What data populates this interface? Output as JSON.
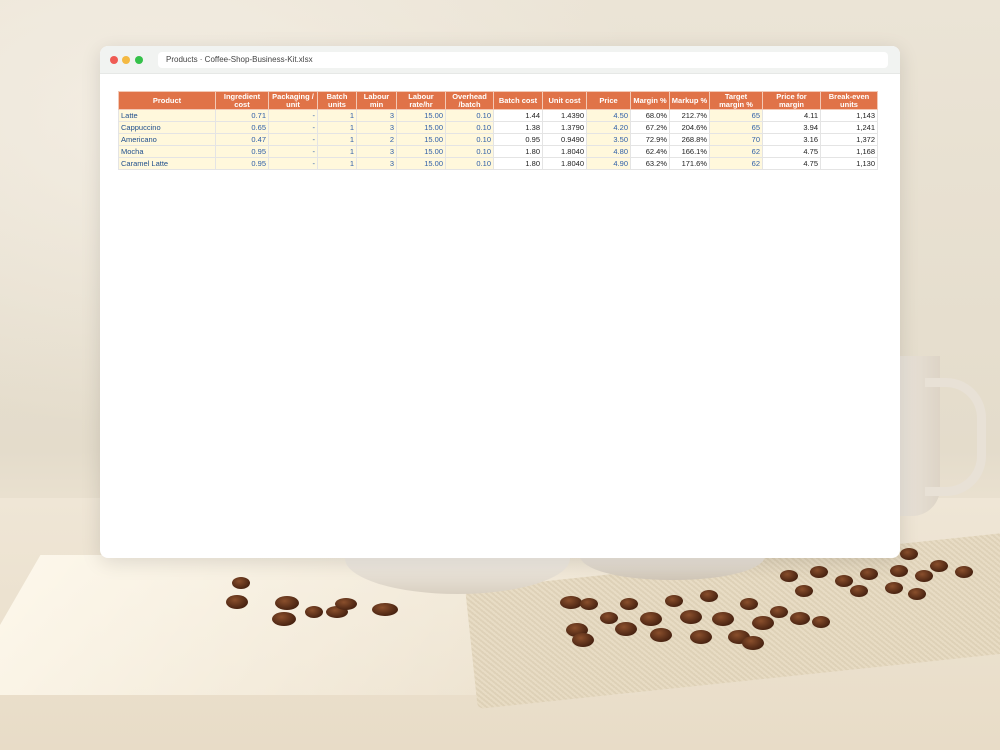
{
  "window": {
    "address": "Products · Coffee-Shop-Business-Kit.xlsx"
  },
  "table": {
    "headers": [
      [
        "Product"
      ],
      [
        "Ingredient",
        "cost"
      ],
      [
        "Packaging /",
        "unit"
      ],
      [
        "Batch",
        "units"
      ],
      [
        "Labour",
        "min"
      ],
      [
        "Labour",
        "rate/hr"
      ],
      [
        "Overhead",
        "/batch"
      ],
      [
        "Batch cost"
      ],
      [
        "Unit cost"
      ],
      [
        "Price"
      ],
      [
        "Margin %"
      ],
      [
        "Markup %"
      ],
      [
        "Target",
        "margin %"
      ],
      [
        "Price for",
        "margin"
      ],
      [
        "Break-even",
        "units"
      ]
    ],
    "rows": [
      [
        "Latte",
        "0.71",
        "-",
        "1",
        "3",
        "15.00",
        "0.10",
        "1.44",
        "1.4390",
        "4.50",
        "68.0%",
        "212.7%",
        "65",
        "4.11",
        "1,143"
      ],
      [
        "Cappuccino",
        "0.65",
        "-",
        "1",
        "3",
        "15.00",
        "0.10",
        "1.38",
        "1.3790",
        "4.20",
        "67.2%",
        "204.6%",
        "65",
        "3.94",
        "1,241"
      ],
      [
        "Americano",
        "0.47",
        "-",
        "1",
        "2",
        "15.00",
        "0.10",
        "0.95",
        "0.9490",
        "3.50",
        "72.9%",
        "268.8%",
        "70",
        "3.16",
        "1,372"
      ],
      [
        "Mocha",
        "0.95",
        "-",
        "1",
        "3",
        "15.00",
        "0.10",
        "1.80",
        "1.8040",
        "4.80",
        "62.4%",
        "166.1%",
        "62",
        "4.75",
        "1,168"
      ],
      [
        "Caramel Latte",
        "0.95",
        "-",
        "1",
        "3",
        "15.00",
        "0.10",
        "1.80",
        "1.8040",
        "4.90",
        "63.2%",
        "171.6%",
        "62",
        "4.75",
        "1,130"
      ]
    ]
  }
}
